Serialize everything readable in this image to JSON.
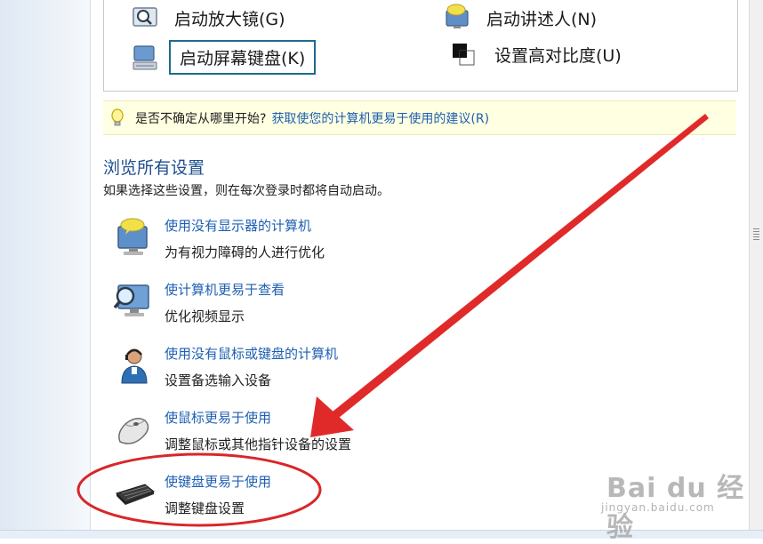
{
  "quick_access": {
    "magnifier_label": "启动放大镜(G)",
    "narrator_label": "启动讲述人(N)",
    "onscreen_keyboard_label": "启动屏幕键盘(K)",
    "high_contrast_label": "设置高对比度(U)"
  },
  "tip": {
    "text": "是否不确定从哪里开始?",
    "link": "获取使您的计算机更易于使用的建议(R)"
  },
  "browse": {
    "title": "浏览所有设置",
    "description": "如果选择这些设置，则在每次登录时都将自动启动。"
  },
  "settings": [
    {
      "link": "使用没有显示器的计算机",
      "description": "为有视力障碍的人进行优化",
      "icon": "monitor-speech-icon"
    },
    {
      "link": "使计算机更易于查看",
      "description": "优化视频显示",
      "icon": "magnifier-monitor-icon"
    },
    {
      "link": "使用没有鼠标或键盘的计算机",
      "description": "设置备选输入设备",
      "icon": "person-headset-icon"
    },
    {
      "link": "使鼠标更易于使用",
      "description": "调整鼠标或其他指针设备的设置",
      "icon": "mouse-icon"
    },
    {
      "link": "使键盘更易于使用",
      "description": "调整键盘设置",
      "icon": "keyboard-icon"
    }
  ],
  "annotation": {
    "arrow_color": "#e02a2a",
    "ellipse_color": "#d9262a"
  },
  "watermark": {
    "brand": "Bai du 经验",
    "site": "jingyan.baidu.com"
  },
  "colors": {
    "link": "#1e5fb2",
    "title": "#1e4f8f",
    "tip_bg": "#ffffe1"
  }
}
